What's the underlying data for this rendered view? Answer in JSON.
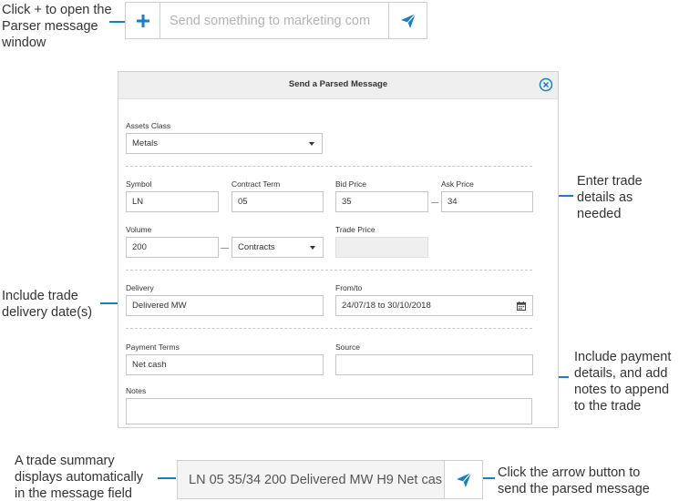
{
  "top_compose": {
    "placeholder": "Send something to marketing com"
  },
  "bottom_compose": {
    "value": "LN 05 35/34 200 Delivered MW H9 Net cas"
  },
  "callouts": {
    "open_parser": [
      "Click + to open the",
      "Parser message",
      "window"
    ],
    "enter_trade": [
      "Enter trade",
      "details as",
      "needed"
    ],
    "delivery": [
      "Include trade",
      "delivery date(s)"
    ],
    "payment": [
      "Include payment",
      "details, and add",
      "notes to append",
      "to the trade"
    ],
    "summary": [
      "A trade summary",
      "displays automatically",
      "in the message field"
    ],
    "arrow": [
      "Click the arrow button to",
      "send the parsed message"
    ]
  },
  "dialog": {
    "title": "Send a Parsed Message",
    "assets_class": {
      "label": "Assets Class",
      "value": "Metals"
    },
    "symbol": {
      "label": "Symbol",
      "value": "LN"
    },
    "contract_term": {
      "label": "Contract Term",
      "value": "05"
    },
    "bid_price": {
      "label": "Bid Price",
      "value": "35"
    },
    "ask_price": {
      "label": "Ask Price",
      "value": "34"
    },
    "volume": {
      "label": "Volume",
      "value": "200",
      "unit": "Contracts"
    },
    "trade_price": {
      "label": "Trade Price",
      "value": ""
    },
    "delivery": {
      "label": "Delivery",
      "value": "Delivered MW"
    },
    "from_to": {
      "label": "From/to",
      "value": "24/07/18 to 30/10/2018"
    },
    "payment_terms": {
      "label": "Payment Terms",
      "value": "Net cash"
    },
    "source": {
      "label": "Source",
      "value": ""
    },
    "notes": {
      "label": "Notes",
      "value": ""
    }
  },
  "colors": {
    "accent": "#1a7fc1"
  },
  "icons": {
    "plus": "plus-icon",
    "send": "paper-plane-icon",
    "close": "close-circle-icon",
    "calendar": "calendar-icon",
    "dropdown": "chevron-down-icon"
  }
}
